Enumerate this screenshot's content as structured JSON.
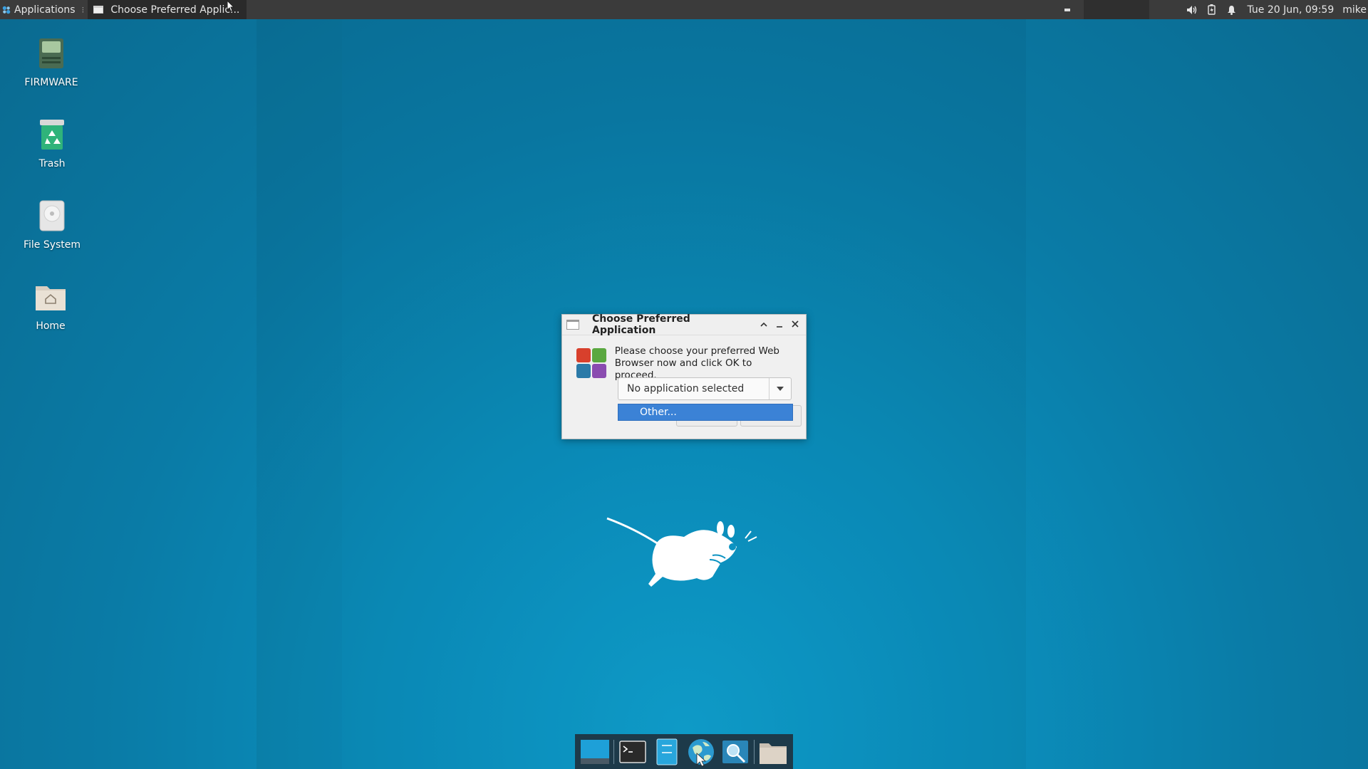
{
  "top_panel": {
    "applications_label": "Applications",
    "task_title": "Choose Preferred Applic...",
    "clock": "Tue 20 Jun, 09:59",
    "user": "mike"
  },
  "desktop_icons": [
    {
      "label": "FIRMWARE",
      "icon": "drive-icon"
    },
    {
      "label": "Trash",
      "icon": "trash-icon"
    },
    {
      "label": "File System",
      "icon": "hard-disk-icon"
    },
    {
      "label": "Home",
      "icon": "home-folder-icon"
    }
  ],
  "dialog": {
    "title": "Choose Preferred Application",
    "message_line1": "Please choose your preferred Web",
    "message_line2": "Browser now and click OK to proceed.",
    "combo_value": "No application selected",
    "dropdown_option": "Other..."
  },
  "dock": [
    "show-desktop-icon",
    "terminal-icon",
    "file-manager-icon",
    "web-browser-icon",
    "app-finder-icon",
    "folder-icon"
  ],
  "colors": {
    "panel": "#3b3b3b",
    "selection": "#3b82d6",
    "desktop": "#0a8fbd"
  }
}
